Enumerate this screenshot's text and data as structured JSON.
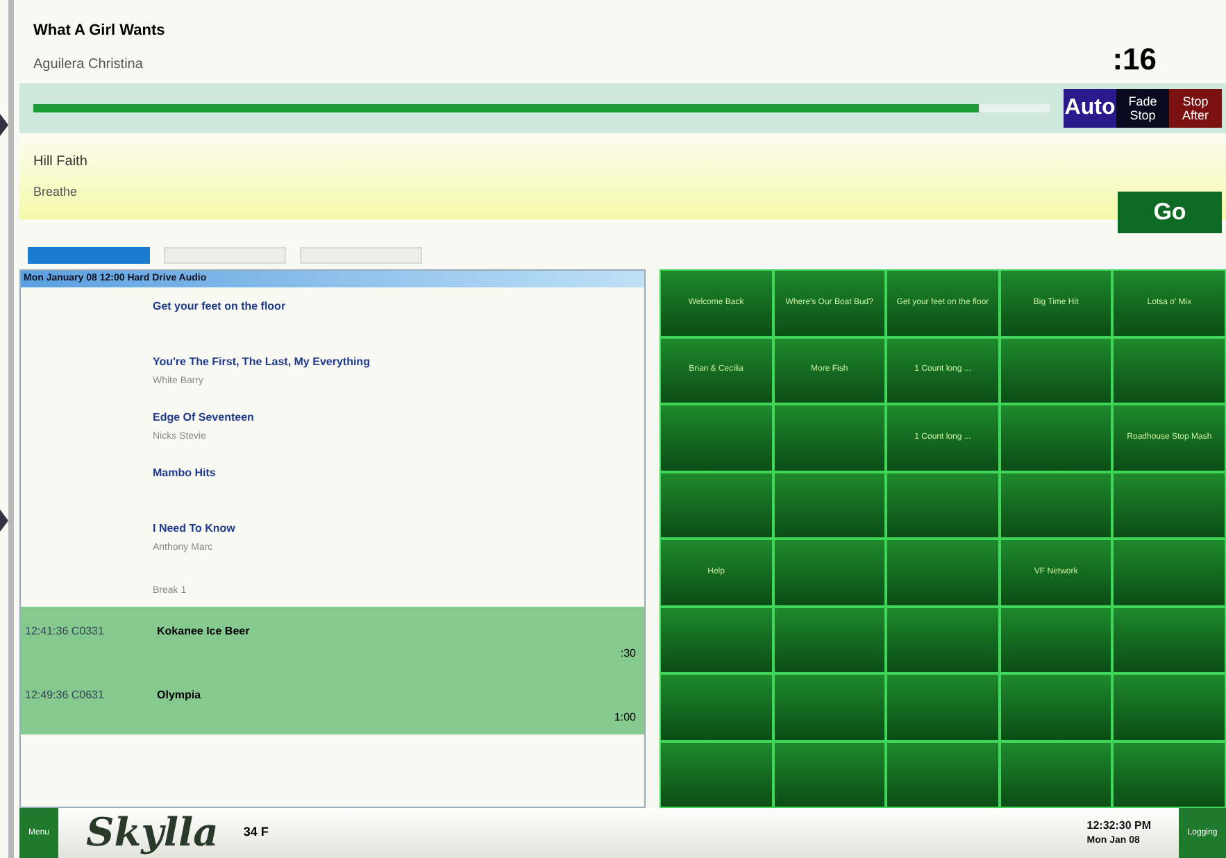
{
  "now_playing": {
    "title": "What A Girl Wants",
    "artist": "Aguilera Christina",
    "countdown": ":16",
    "level": 0.93
  },
  "transport": [
    {
      "label": "Auto",
      "kind": "auto"
    },
    {
      "label": "Fade Stop",
      "kind": "fade"
    },
    {
      "label": "Stop After",
      "kind": "stop"
    }
  ],
  "next": {
    "title": "Breathe",
    "artist": "Hill Faith",
    "go": "Go"
  },
  "tabs": [
    {
      "selected": true
    },
    {
      "selected": false
    },
    {
      "selected": false
    }
  ],
  "log": {
    "header": "Mon January 08 12:00 Hard Drive Audio",
    "rows": [
      {
        "title": "Get your feet on the floor",
        "kind": "song"
      },
      {
        "title": "You're The First, The Last, My Everything",
        "artist": "White Barry",
        "kind": "song"
      },
      {
        "title": "Edge Of Seventeen",
        "artist": "Nicks Stevie",
        "kind": "song"
      },
      {
        "title": "Mambo Hits",
        "kind": "song"
      },
      {
        "title": "I Need To Know",
        "artist": "Anthony Marc",
        "kind": "song"
      },
      {
        "title": "Break 1",
        "kind": "break"
      },
      {
        "time": "12:41:36 C0331",
        "title": "Kokanee Ice Beer",
        "length": ":30",
        "kind": "spot"
      },
      {
        "time": "12:49:36 C0631",
        "title": "Olympia",
        "length": "1:00",
        "kind": "spot"
      }
    ]
  },
  "grid": [
    [
      {
        "kind": "cart",
        "label": "Welcome Back"
      },
      {
        "kind": "cart",
        "label": "Where's Our Boat Bud?"
      },
      {
        "kind": "cart",
        "label": "Get your feet on the floor"
      },
      {
        "kind": "cart",
        "label": "Big Time Hit"
      },
      {
        "kind": "cart",
        "label": "Lotsa o' Mix"
      }
    ],
    [
      {
        "kind": "cart",
        "label": "Brian & Cecilia"
      },
      {
        "kind": "cart",
        "label": "More Fish"
      },
      {
        "kind": "cart",
        "label": "1 Count long ..."
      },
      {
        "kind": "blank"
      },
      {
        "kind": "blank"
      }
    ],
    [
      {
        "kind": "blank"
      },
      {
        "kind": "blank"
      },
      {
        "kind": "cart",
        "label": "1 Count long ..."
      },
      {
        "kind": "blank"
      },
      {
        "kind": "cart",
        "label": "Roadhouse Stop Mash"
      }
    ],
    [
      {
        "kind": "blank"
      },
      {
        "kind": "blank"
      },
      {
        "kind": "blank"
      },
      {
        "kind": "blank"
      },
      {
        "kind": "blank"
      }
    ],
    [
      {
        "kind": "cart",
        "label": "Help"
      },
      {
        "kind": "blank"
      },
      {
        "kind": "blank"
      },
      {
        "kind": "cart",
        "label": "VF Network"
      },
      {
        "kind": "blank"
      }
    ],
    [
      {
        "kind": "blank"
      },
      {
        "kind": "blank"
      },
      {
        "kind": "blank"
      },
      {
        "kind": "blank"
      },
      {
        "kind": "blank"
      }
    ],
    [
      {
        "kind": "blank"
      },
      {
        "kind": "blank"
      },
      {
        "kind": "blank"
      },
      {
        "kind": "blank"
      },
      {
        "kind": "blank"
      }
    ],
    [
      {
        "kind": "blank"
      },
      {
        "kind": "blank"
      },
      {
        "kind": "blank"
      },
      {
        "kind": "blank"
      },
      {
        "kind": "blank"
      }
    ]
  ],
  "footer": {
    "menu": "Menu",
    "logo": "Skylla",
    "temperature": "34 F",
    "time": "12:32:30 PM",
    "date": "Mon Jan 08",
    "logging": "Logging"
  }
}
